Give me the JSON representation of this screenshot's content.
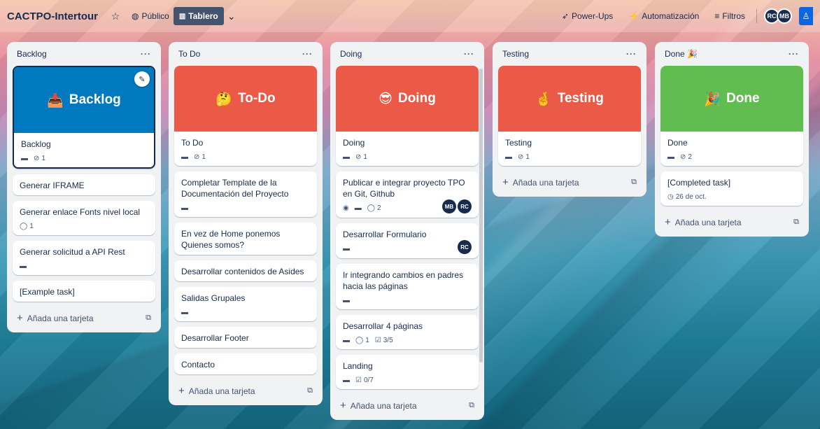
{
  "header": {
    "board_title": "CACTPO-Intertour",
    "star_icon": "star-icon",
    "visibility_label": "Público",
    "view_label": "Tablero",
    "powerups_label": "Power-Ups",
    "automation_label": "Automatización",
    "filters_label": "Filtros",
    "avatars": [
      "RC",
      "MB"
    ]
  },
  "lists": [
    {
      "name": "Backlog",
      "menu": "···",
      "cards": [
        {
          "cover_text": "Backlog",
          "cover_emoji": "📥",
          "cover_color": "#0079bf",
          "title": "Backlog",
          "attachments": "1"
        },
        {
          "title": "Generar IFRAME"
        },
        {
          "title": "Generar enlace Fonts nivel local",
          "comments": "1"
        },
        {
          "title": "Generar solicitud a API Rest"
        },
        {
          "title": "[Example task]"
        }
      ],
      "add_label": "Añada una tarjeta"
    },
    {
      "name": "To Do",
      "menu": "···",
      "cards": [
        {
          "cover_text": "To-Do",
          "cover_emoji": "🤔",
          "cover_color": "#eb5a46",
          "title": "To Do",
          "attachments": "1"
        },
        {
          "title": "Completar Template de la Documentación del Proyecto"
        },
        {
          "title": "En vez de Home ponemos Quienes somos?"
        },
        {
          "title": "Desarrollar contenidos de Asides"
        },
        {
          "title": "Salidas Grupales"
        },
        {
          "title": "Desarrollar Footer"
        },
        {
          "title": "Contacto"
        }
      ],
      "add_label": "Añada una tarjeta"
    },
    {
      "name": "Doing",
      "menu": "···",
      "cards": [
        {
          "cover_text": "Doing",
          "cover_emoji": "😎",
          "cover_color": "#eb5a46",
          "title": "Doing",
          "attachments": "1"
        },
        {
          "title": "Publicar e integrar proyecto TPO en Git, Github",
          "comments": "2",
          "members": [
            "MB",
            "RC"
          ]
        },
        {
          "title": "Desarrollar Formulario",
          "members": [
            "RC"
          ]
        },
        {
          "title": "Ir integrando cambios en padres hacia las páginas"
        },
        {
          "title": "Desarrollar 4 páginas",
          "comments": "1",
          "checklist": "3/5"
        },
        {
          "title": "Landing",
          "checklist": "0/7"
        }
      ],
      "add_label": "Añada una tarjeta"
    },
    {
      "name": "Testing",
      "menu": "···",
      "cards": [
        {
          "cover_text": "Testing",
          "cover_emoji": "🤞",
          "cover_color": "#eb5a46",
          "title": "Testing",
          "attachments": "1"
        }
      ],
      "add_label": "Añada una tarjeta"
    },
    {
      "name": "Done",
      "name_emoji": "🎉",
      "menu": "···",
      "cards": [
        {
          "cover_text": "Done",
          "cover_emoji": "🎉",
          "cover_color": "#61bd4f",
          "title": "Done",
          "attachments": "2"
        },
        {
          "title": "[Completed task]",
          "due": "26 de oct."
        }
      ],
      "add_label": "Añada una tarjeta"
    }
  ]
}
